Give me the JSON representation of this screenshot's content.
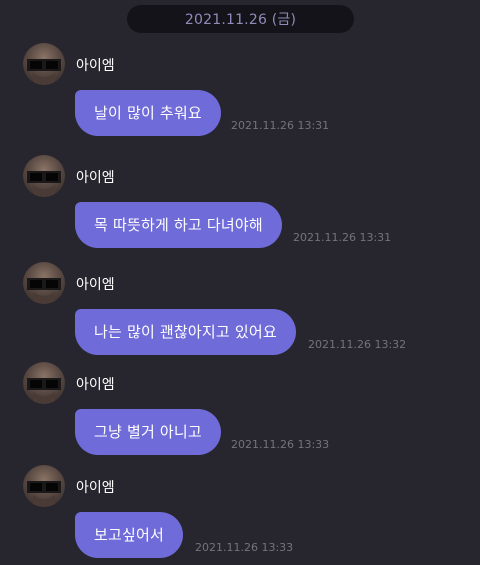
{
  "date_divider": "2021.11.26 (금)",
  "messages": [
    {
      "sender": "아이엠",
      "text": "날이 많이 추워요",
      "time": "2021.11.26 13:31"
    },
    {
      "sender": "아이엠",
      "text": "목 따뜻하게 하고 다녀야해",
      "time": "2021.11.26 13:31"
    },
    {
      "sender": "아이엠",
      "text": "나는 많이 괜찮아지고 있어요",
      "time": "2021.11.26 13:32"
    },
    {
      "sender": "아이엠",
      "text": "그냥 별거 아니고",
      "time": "2021.11.26 13:33"
    },
    {
      "sender": "아이엠",
      "text": "보고싶어서",
      "time": "2021.11.26 13:33"
    }
  ],
  "colors": {
    "background": "#27262f",
    "bubble": "#6f6bd8",
    "date_pill": "#141319",
    "date_text": "#8f8bb8",
    "timestamp": "#74737c"
  }
}
